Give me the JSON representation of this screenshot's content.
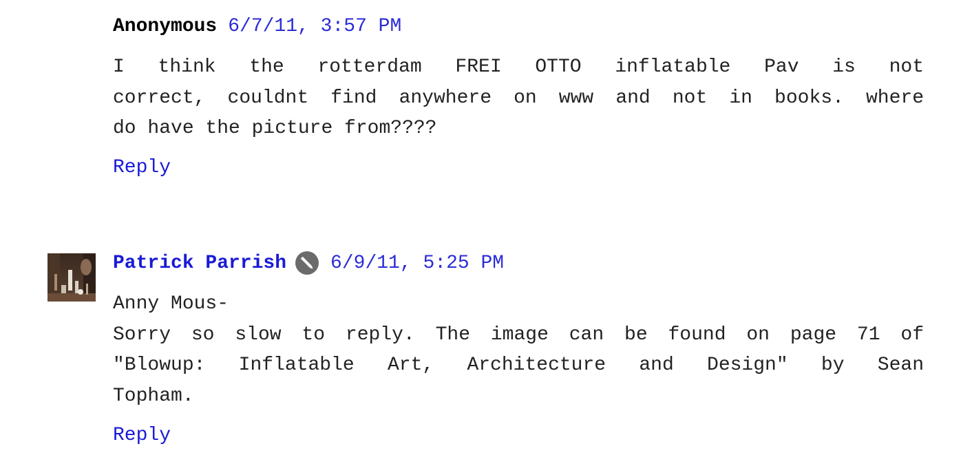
{
  "comments": [
    {
      "author": "Anonymous",
      "timestamp": "6/7/11, 3:57 PM",
      "body_lines": [
        "I think the rotterdam FREI OTTO inflatable Pav is not",
        "correct, couldnt find anywhere on www and not in books. where",
        "do have the picture from????"
      ],
      "reply_label": "Reply"
    },
    {
      "author": "Patrick Parrish",
      "timestamp": "6/9/11, 5:25 PM",
      "author_badge_icon": "pencil-icon",
      "body_lines": [
        "Anny Mous-",
        "Sorry so slow to reply. The image can be found on page 71 of",
        "\"Blowup: Inflatable Art, Architecture and Design\" by Sean",
        "Topham."
      ],
      "reply_label": "Reply"
    }
  ],
  "colors": {
    "link": "#1a1ad6",
    "text": "#222222",
    "author_plain": "#000000",
    "badge": "#6b6b6b"
  }
}
